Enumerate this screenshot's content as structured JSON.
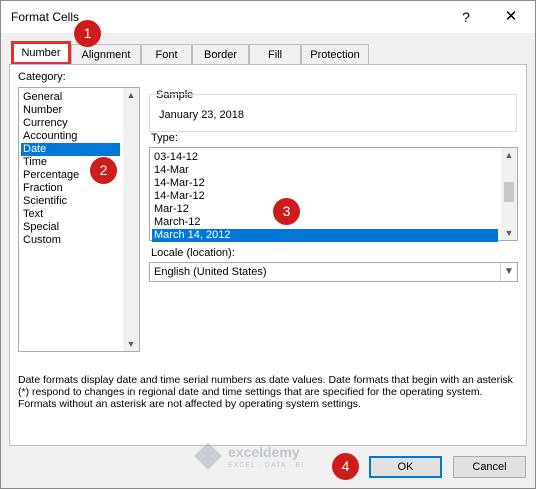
{
  "window": {
    "title": "Format Cells",
    "help_glyph": "?",
    "close_glyph": "✕"
  },
  "tabs": [
    {
      "label": "Number",
      "active": true
    },
    {
      "label": "Alignment",
      "active": false
    },
    {
      "label": "Font",
      "active": false
    },
    {
      "label": "Border",
      "active": false
    },
    {
      "label": "Fill",
      "active": false
    },
    {
      "label": "Protection",
      "active": false
    }
  ],
  "category": {
    "label": "Category:",
    "items": [
      "General",
      "Number",
      "Currency",
      "Accounting",
      "Date",
      "Time",
      "Percentage",
      "Fraction",
      "Scientific",
      "Text",
      "Special",
      "Custom"
    ],
    "selected": "Date"
  },
  "sample": {
    "label": "Sample",
    "value": "January 23, 2018"
  },
  "type": {
    "label": "Type:",
    "items": [
      "03-14-12",
      "14-Mar",
      "14-Mar-12",
      "14-Mar-12",
      "Mar-12",
      "March-12",
      "March 14, 2012"
    ],
    "selected": "March 14, 2012"
  },
  "locale": {
    "label": "Locale (location):",
    "value": "English (United States)"
  },
  "description": "Date formats display date and time serial numbers as date values.  Date formats that begin with an asterisk (*) respond to changes in regional date and time settings that are specified for the operating system. Formats without an asterisk are not affected by operating system settings.",
  "buttons": {
    "ok": "OK",
    "cancel": "Cancel"
  },
  "watermark": {
    "name": "exceldemy",
    "tagline": "EXCEL · DATA · BI"
  },
  "badges": [
    "1",
    "2",
    "3",
    "4"
  ],
  "colors": {
    "selection": "#0078d7",
    "badge": "#cc1c1c",
    "highlight_border": "#e03030"
  }
}
